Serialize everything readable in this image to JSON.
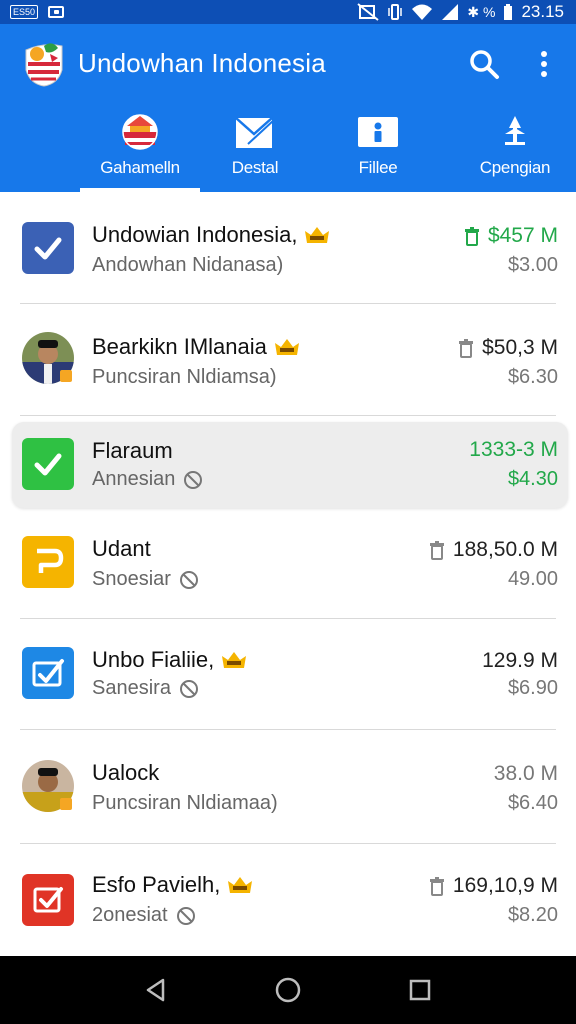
{
  "status_bar": {
    "badge": "ES50",
    "indicators": "✱ %",
    "time": "23.15"
  },
  "app": {
    "title": "Undowhan Indonesia"
  },
  "tabs": [
    {
      "label": "Gahamelln",
      "icon": "flag-emblem-icon",
      "active": true
    },
    {
      "label": "Destal",
      "icon": "envelope-icon",
      "active": false
    },
    {
      "label": "Fillee",
      "icon": "file-icon",
      "active": false
    },
    {
      "label": "Cpengian",
      "icon": "pin-icon",
      "active": false
    }
  ],
  "items": [
    {
      "name": "Undowian Indonesia,",
      "sub": "Andowhan Nidanasa)",
      "amount": "$457 M",
      "price": "$3.00",
      "icon": "blue-checkbox-icon",
      "crown": true,
      "ban": false,
      "trash": true,
      "amount_green": true,
      "price_green": false
    },
    {
      "name": "Bearkikn IMlanaia",
      "sub": "Puncsiran Nldiamsa)",
      "amount": "$50,3 M",
      "price": "$6.30",
      "icon": "avatar",
      "crown": true,
      "ban": false,
      "trash": true,
      "amount_green": false,
      "price_green": false
    },
    {
      "name": "Flaraum",
      "sub": "Annesian",
      "amount": "1333-3 M",
      "price": "$4.30",
      "icon": "green-checkbox-icon",
      "crown": false,
      "ban": true,
      "trash": false,
      "amount_green": true,
      "price_green": true
    },
    {
      "name": "Udant",
      "sub": "Snoesiar",
      "amount": "188,50.0 M",
      "price": "49.00",
      "icon": "yellow-p-icon",
      "crown": false,
      "ban": true,
      "trash": true,
      "amount_green": false,
      "price_green": false
    },
    {
      "name": "Unbo Fialiie,",
      "sub": "Sanesira",
      "amount": "129.9 M",
      "price": "$6.90",
      "icon": "blue-check-icon",
      "crown": true,
      "ban": true,
      "trash": false,
      "amount_green": false,
      "price_green": false
    },
    {
      "name": "Ualock",
      "sub": "Puncsiran Nldiamaa)",
      "amount": "38.0 M",
      "price": "$6.40",
      "icon": "avatar",
      "crown": false,
      "ban": false,
      "trash": false,
      "amount_green": false,
      "price_green": false
    },
    {
      "name": "Esfo Pavielh,",
      "sub": "2onesiat",
      "amount": "169,10,9 M",
      "price": "$8.20",
      "icon": "red-checkbox-icon",
      "crown": true,
      "ban": true,
      "trash": true,
      "amount_green": false,
      "price_green": false
    }
  ],
  "colors": {
    "app_bar": "#1778ea",
    "status_bar": "#0d4fb5",
    "accent_green": "#22a84a"
  }
}
